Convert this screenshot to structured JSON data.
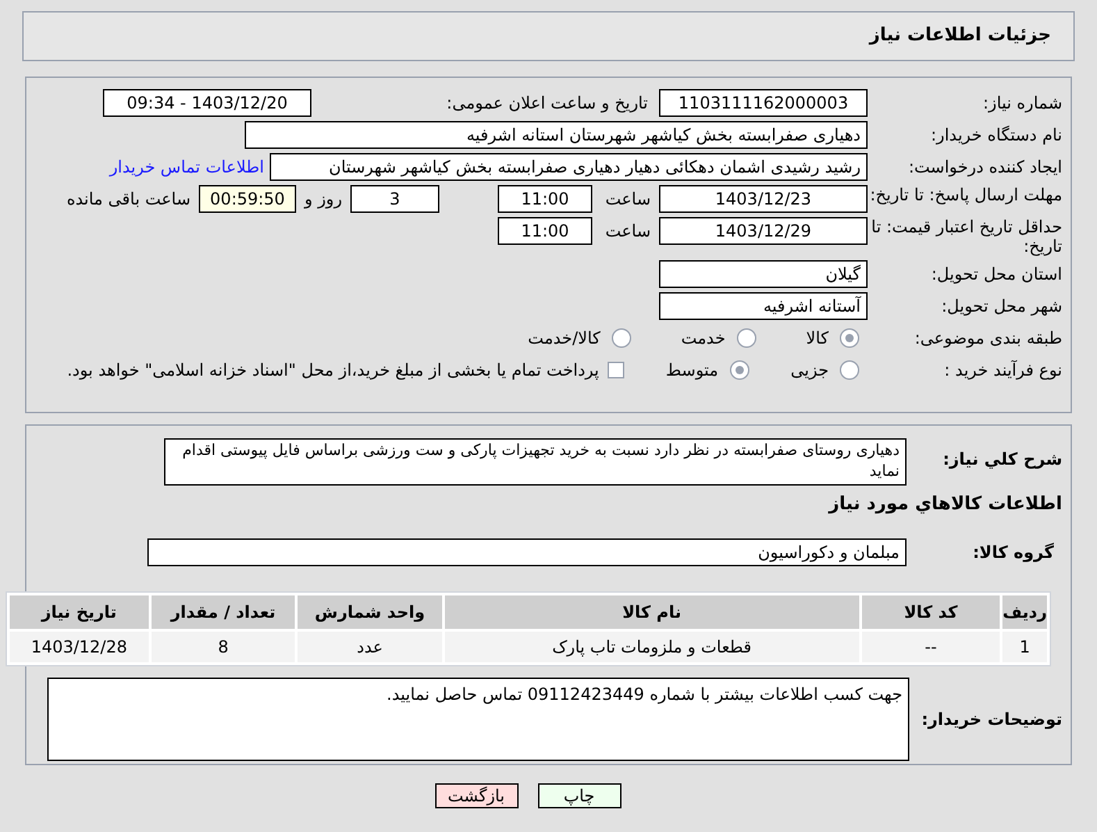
{
  "header": {
    "title": "جزئیات اطلاعات نیاز"
  },
  "need_number": {
    "label": "شماره نیاز:",
    "value": "1103111162000003"
  },
  "announce": {
    "label": "تاریخ و ساعت اعلان عمومی:",
    "value": "1403/12/20 - 09:34"
  },
  "buyer": {
    "label": "نام دستگاه خریدار:",
    "value": "دهیاری صفرابسته بخش کیاشهر شهرستان استانه اشرفیه"
  },
  "creator": {
    "label": "ایجاد کننده درخواست:",
    "value": "رشید رشیدی اشمان دهکائی دهیار دهیاری صفرابسته بخش کیاشهر شهرستان",
    "link": "اطلاعات تماس خریدار"
  },
  "deadline": {
    "label": "مهلت ارسال پاسخ: تا تاریخ:",
    "date": "1403/12/23",
    "time_label": "ساعت",
    "time": "11:00",
    "days": "3",
    "days_label": "روز و",
    "remaining": "00:59:50",
    "remaining_label": "ساعت باقی مانده"
  },
  "validity": {
    "label": "حداقل تاریخ اعتبار قیمت: تا تاریخ:",
    "date": "1403/12/29",
    "time_label": "ساعت",
    "time": "11:00"
  },
  "province": {
    "label": "استان محل تحویل:",
    "value": "گیلان"
  },
  "city": {
    "label": "شهر محل تحویل:",
    "value": "آستانه اشرفیه"
  },
  "category": {
    "label": "طبقه بندی موضوعی:",
    "options": [
      {
        "label": "کالا",
        "selected": true
      },
      {
        "label": "خدمت",
        "selected": false
      },
      {
        "label": "کالا/خدمت",
        "selected": false
      }
    ]
  },
  "purchase_type": {
    "label": "نوع فرآیند خرید :",
    "options": [
      {
        "label": "جزیی",
        "selected": false
      },
      {
        "label": "متوسط",
        "selected": true
      }
    ],
    "treasury": {
      "checked": false,
      "text": "پرداخت تمام یا بخشی از مبلغ خرید،از محل \"اسناد خزانه اسلامی\" خواهد بود."
    }
  },
  "description": {
    "label": "شرح کلي نياز:",
    "value": "دهیاری روستای صفرابسته در نظر دارد نسبت به خرید تجهیزات پارکی و ست ورزشی براساس فایل پیوستی اقدام نماید"
  },
  "goods_title": "اطلاعات کالاهاي مورد نياز",
  "goods_group": {
    "label": "گروه کالا:",
    "value": "مبلمان و دکوراسیون"
  },
  "table": {
    "columns": [
      "ردیف",
      "کد کالا",
      "نام کالا",
      "واحد شمارش",
      "تعداد / مقدار",
      "تاریخ نیاز"
    ],
    "rows": [
      [
        "1",
        "--",
        "قطعات و ملزومات تاب پارک",
        "عدد",
        "8",
        "1403/12/28"
      ]
    ]
  },
  "buyer_notes": {
    "label": "توضیحات خریدار:",
    "value": "جهت کسب اطلاعات بیشتر با شماره 09112423449 تماس حاصل نمایید."
  },
  "buttons": [
    {
      "label": "چاپ",
      "kind": "print"
    },
    {
      "label": "بازگشت",
      "kind": "back"
    }
  ]
}
